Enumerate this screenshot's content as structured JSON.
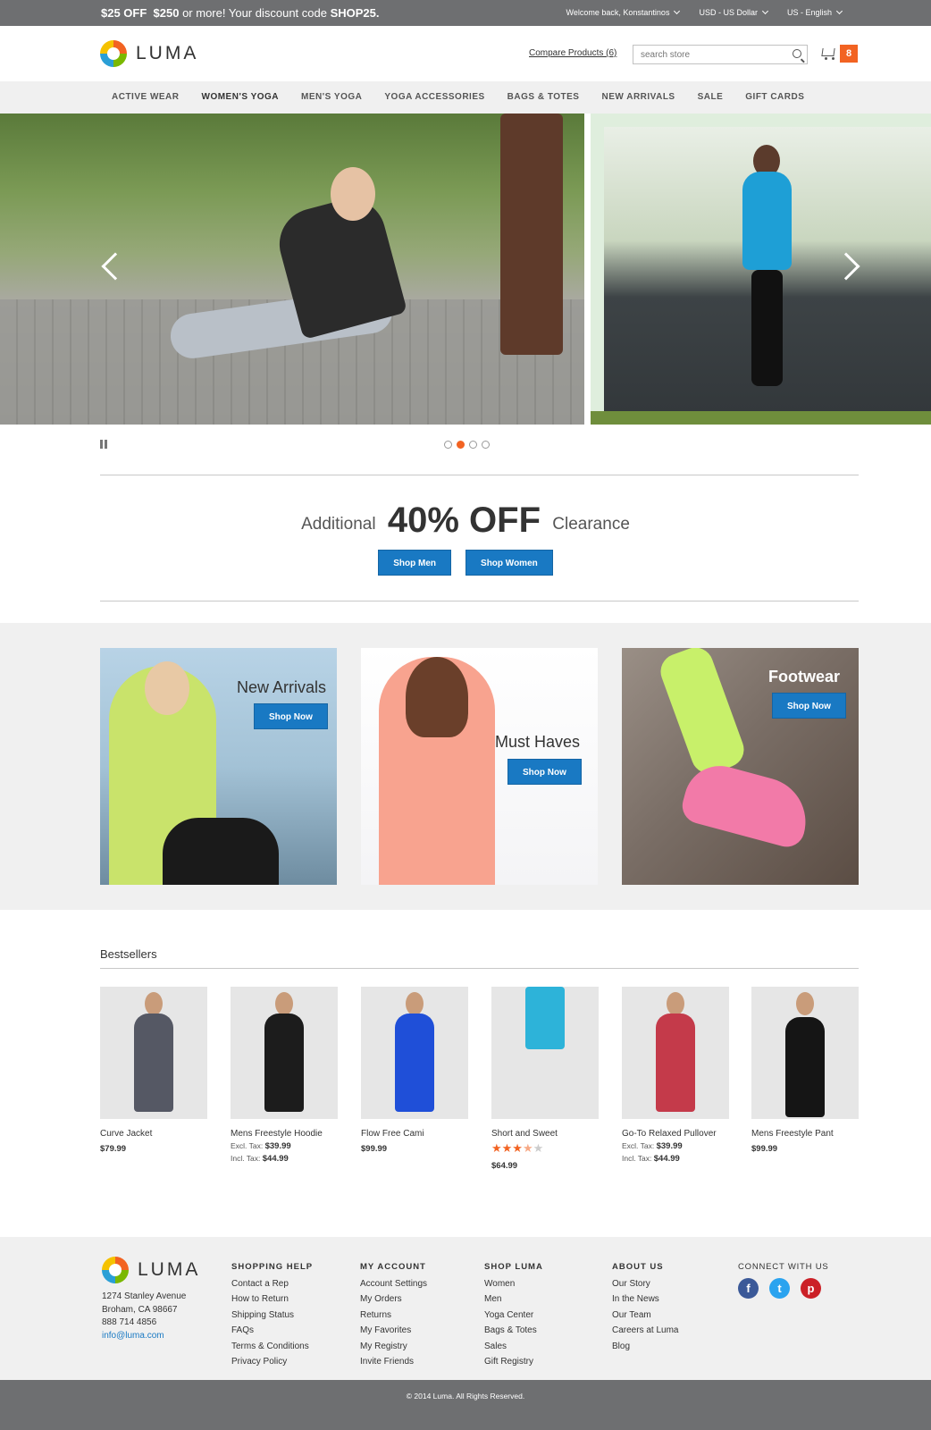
{
  "topbar": {
    "promo_prefix": "$25 OFF",
    "promo_amount": "$250",
    "promo_middle": "or more! Your discount code",
    "promo_code": "SHOP25.",
    "welcome": "Welcome back, Konstantinos",
    "currency": "USD - US Dollar",
    "language": "US - English"
  },
  "header": {
    "logo_text": "LUMA",
    "compare": "Compare Products (6)",
    "search_placeholder": "search store",
    "cart_count": "8"
  },
  "nav": {
    "items": [
      "ACTIVE WEAR",
      "WOMEN'S YOGA",
      "MEN'S YOGA",
      "YOGA ACCESSORIES",
      "BAGS & TOTES",
      "NEW ARRIVALS",
      "SALE",
      "GIFT CARDS"
    ],
    "active_index": 1
  },
  "slider": {
    "slide_count": 4,
    "active_slide": 1
  },
  "clearance": {
    "prefix": "Additional",
    "headline": "40% OFF",
    "suffix": "Clearance",
    "shop_men": "Shop Men",
    "shop_women": "Shop Women"
  },
  "categories": [
    {
      "title": "New Arrivals",
      "button": "Shop Now"
    },
    {
      "title": "Must Haves",
      "button": "Shop Now"
    },
    {
      "title": "Footwear",
      "button": "Shop Now"
    }
  ],
  "bestsellers": {
    "title": "Bestsellers",
    "products": [
      {
        "name": "Curve Jacket",
        "price": "$79.99"
      },
      {
        "name": "Mens Freestyle Hoodie",
        "excl_label": "Excl. Tax:",
        "excl": "$39.99",
        "incl_label": "Incl. Tax:",
        "incl": "$44.99"
      },
      {
        "name": "Flow Free Cami",
        "price": "$99.99"
      },
      {
        "name": "Short and Sweet",
        "rating": 3.5,
        "price": "$64.99"
      },
      {
        "name": "Go-To Relaxed Pullover",
        "excl_label": "Excl. Tax:",
        "excl": "$39.99",
        "incl_label": "Incl. Tax:",
        "incl": "$44.99"
      },
      {
        "name": "Mens Freestyle Pant",
        "price": "$99.99"
      }
    ]
  },
  "footer": {
    "logo_text": "LUMA",
    "address": [
      "1274 Stanley Avenue",
      "Broham, CA 98667",
      "888 714 4856"
    ],
    "email": "info@luma.com",
    "columns": [
      {
        "title": "SHOPPING HELP",
        "items": [
          "Contact a Rep",
          "How to Return",
          "Shipping Status",
          "FAQs",
          "Terms & Conditions",
          "Privacy Policy"
        ]
      },
      {
        "title": "MY ACCOUNT",
        "items": [
          "Account Settings",
          "My Orders",
          "Returns",
          "My Favorites",
          "My Registry",
          "Invite Friends"
        ]
      },
      {
        "title": "SHOP LUMA",
        "items": [
          "Women",
          "Men",
          "Yoga Center",
          "Bags & Totes",
          "Sales",
          "Gift Registry"
        ]
      },
      {
        "title": "ABOUT US",
        "items": [
          "Our Story",
          "In the News",
          "Our Team",
          "Careers at Luma",
          "Blog"
        ]
      }
    ],
    "social_title": "CONNECT WITH US",
    "social": [
      "facebook-icon",
      "twitter-icon",
      "pinterest-icon"
    ],
    "copyright": "© 2014 Luma. All Rights Reserved."
  },
  "colors": {
    "accent": "#f26322",
    "button": "#1979c3",
    "bar": "#6e6f71"
  }
}
